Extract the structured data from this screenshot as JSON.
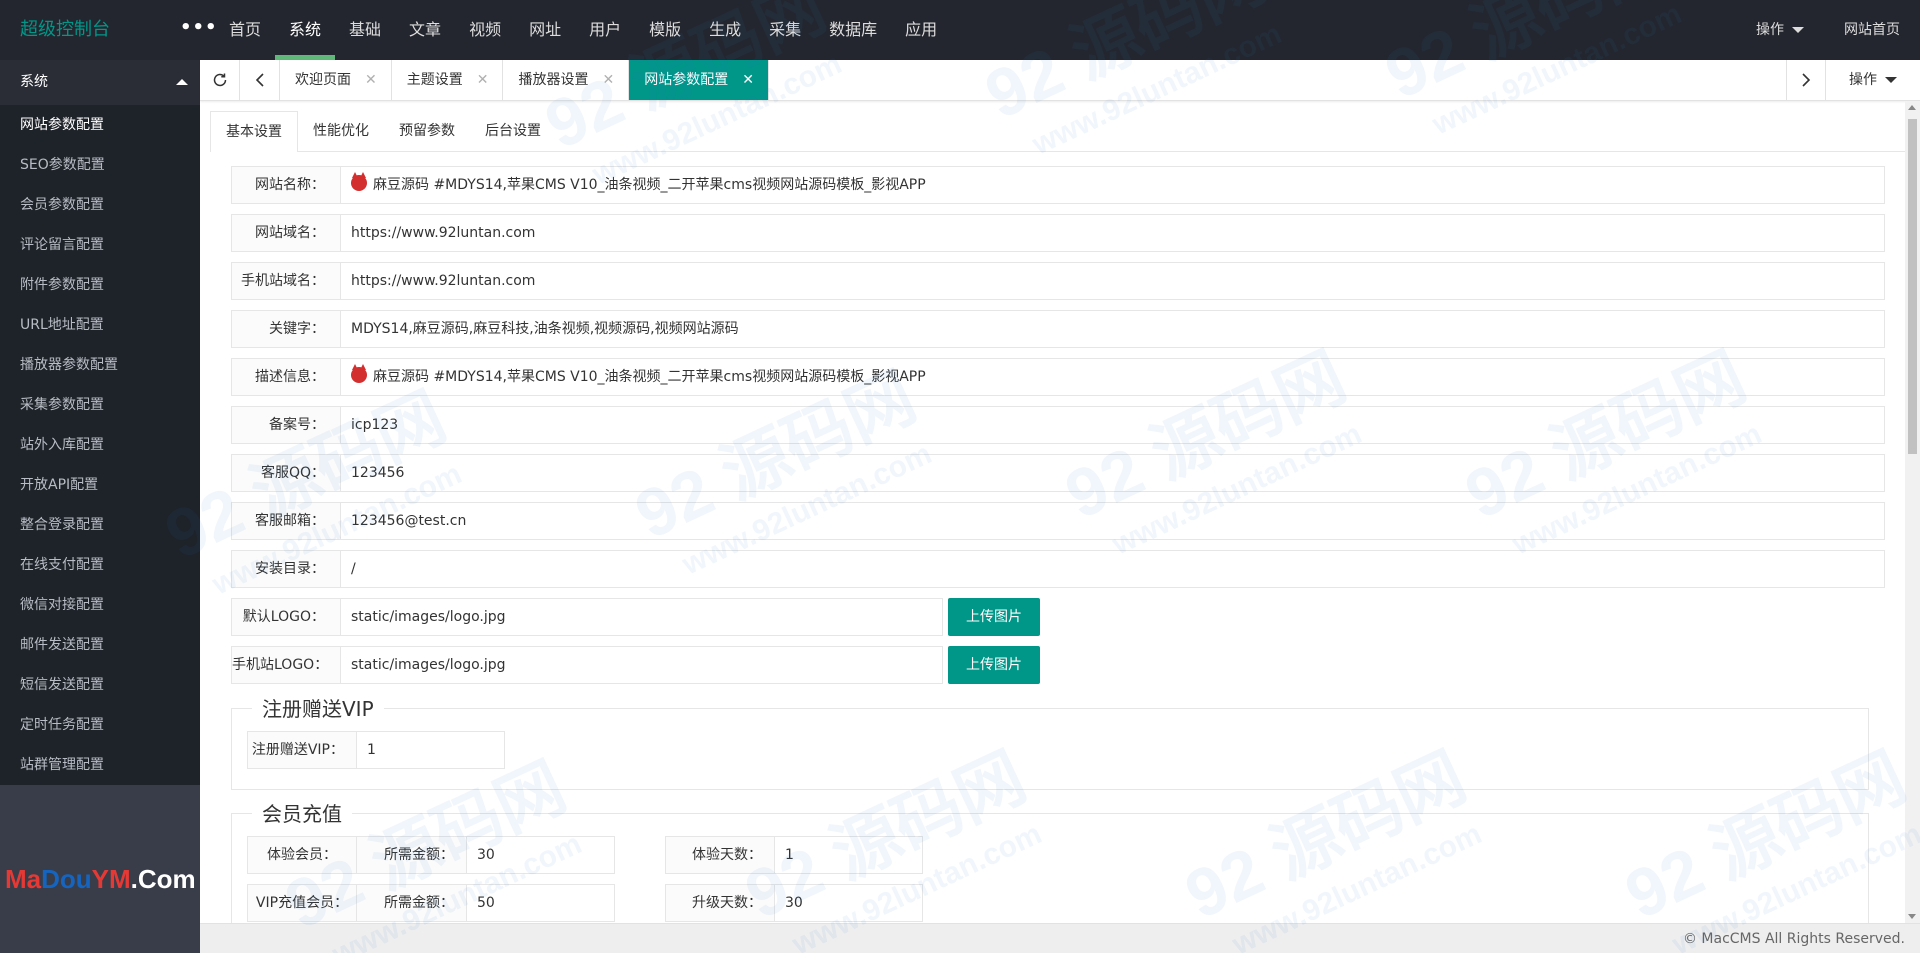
{
  "header": {
    "logo": "超级控制台",
    "more_label": "•••",
    "nav": [
      "首页",
      "系统",
      "基础",
      "文章",
      "视频",
      "网址",
      "用户",
      "模版",
      "生成",
      "采集",
      "数据库",
      "应用"
    ],
    "right": {
      "operate": "操作",
      "home": "网站首页"
    }
  },
  "sidebar": {
    "group": "系统",
    "items": [
      "网站参数配置",
      "SEO参数配置",
      "会员参数配置",
      "评论留言配置",
      "附件参数配置",
      "URL地址配置",
      "播放器参数配置",
      "采集参数配置",
      "站外入库配置",
      "开放API配置",
      "整合登录配置",
      "在线支付配置",
      "微信对接配置",
      "邮件发送配置",
      "短信发送配置",
      "定时任务配置",
      "站群管理配置"
    ],
    "brand": {
      "m": "Ma",
      "d": "Dou",
      "y": "YM",
      "c": ".Com"
    }
  },
  "tabbar": {
    "tabs": [
      "欢迎页面",
      "主题设置",
      "播放器设置",
      "网站参数配置"
    ],
    "operate": "操作"
  },
  "subtabs": [
    "基本设置",
    "性能优化",
    "预留参数",
    "后台设置"
  ],
  "form": {
    "site_name": {
      "label": "网站名称：",
      "value": "麻豆源码 #MDYS14,苹果CMS V10_油条视频_二开苹果cms视频网站源码模板_影视APP"
    },
    "site_domain": {
      "label": "网站域名：",
      "value": "https://www.92luntan.com"
    },
    "mobile_domain": {
      "label": "手机站域名：",
      "value": "https://www.92luntan.com"
    },
    "keywords": {
      "label": "关键字：",
      "value": "MDYS14,麻豆源码,麻豆科技,油条视频,视频源码,视频网站源码"
    },
    "description": {
      "label": "描述信息：",
      "value": "麻豆源码 #MDYS14,苹果CMS V10_油条视频_二开苹果cms视频网站源码模板_影视APP"
    },
    "icp": {
      "label": "备案号：",
      "value": "icp123"
    },
    "qq": {
      "label": "客服QQ：",
      "value": "123456"
    },
    "email": {
      "label": "客服邮箱：",
      "value": "123456@test.cn"
    },
    "install_dir": {
      "label": "安装目录：",
      "value": "/"
    },
    "logo": {
      "label": "默认LOGO：",
      "value": "static/images/logo.jpg"
    },
    "mobile_logo": {
      "label": "手机站LOGO：",
      "value": "static/images/logo.jpg"
    },
    "upload_label": "上传图片"
  },
  "reg_vip": {
    "legend": "注册赠送VIP",
    "label": "注册赠送VIP：",
    "value": "1"
  },
  "recharge": {
    "legend": "会员充值",
    "rows": [
      {
        "type": "体验会员：",
        "amount_label": "所需金额：",
        "amount": "30",
        "days_label": "体验天数：",
        "days": "1"
      },
      {
        "type": "VIP充值会员：",
        "amount_label": "所需金额：",
        "amount": "50",
        "days_label": "升级天数：",
        "days": "30"
      }
    ]
  },
  "footer": "© MacCMS All Rights Reserved.",
  "watermark": {
    "brand": "92 源码网",
    "url": "www.92luntan.com"
  },
  "colors": {
    "accent": "#009688",
    "header_bg": "#23262e",
    "sidebar_bg": "#393d49",
    "nav_active": "#5fb878"
  },
  "icons": {
    "refresh": "refresh-icon",
    "prev": "chevron-left-icon",
    "next": "chevron-right-icon",
    "close": "close-icon",
    "caret": "caret-down-icon",
    "group": "caret-up-icon"
  }
}
